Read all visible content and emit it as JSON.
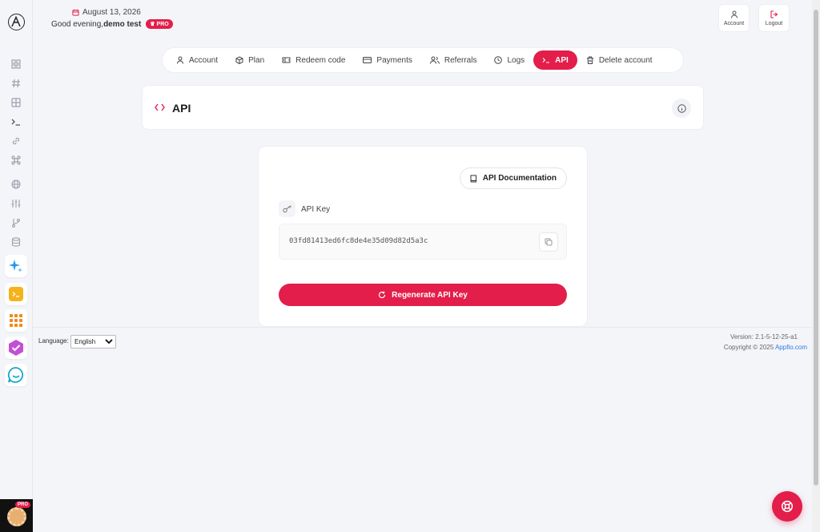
{
  "colors": {
    "accent": "#e31e4a",
    "link": "#2a7ae2",
    "background": "#f4f5f9"
  },
  "header": {
    "date": "August 13, 2026",
    "greeting": "Good evening,",
    "user_name": "demo test",
    "pro_label": "PRO",
    "account_label": "Account",
    "logout_label": "Logout"
  },
  "sidebar": {
    "icons": [
      "grid-icon",
      "hash-icon",
      "table-icon",
      "terminal-icon",
      "link-icon",
      "command-icon",
      "globe-icon",
      "sliders-icon",
      "git-branch-icon",
      "database-icon"
    ],
    "apps": [
      "sparkle-app-icon",
      "terminal-app-icon",
      "grid-app-icon",
      "check-app-icon",
      "chat-app-icon"
    ],
    "avatar_pro_label": "PRO"
  },
  "tabs": [
    {
      "label": "Account",
      "icon": "user-icon"
    },
    {
      "label": "Plan",
      "icon": "box-icon"
    },
    {
      "label": "Redeem code",
      "icon": "ticket-icon"
    },
    {
      "label": "Payments",
      "icon": "credit-card-icon"
    },
    {
      "label": "Referrals",
      "icon": "users-icon"
    },
    {
      "label": "Logs",
      "icon": "clock-icon"
    },
    {
      "label": "API",
      "icon": "terminal-icon",
      "active": true
    },
    {
      "label": "Delete account",
      "icon": "trash-icon"
    }
  ],
  "page": {
    "title": "API"
  },
  "api": {
    "doc_button": "API Documentation",
    "key_label": "API Key",
    "key_value": "03fd81413ed6fc8de4e35d09d82d5a3c",
    "regenerate_button": "Regenerate API Key"
  },
  "footer": {
    "language_label": "Language:",
    "language_value": "English",
    "version": "Version: 2.1-5-12-25-a1",
    "copyright_prefix": "Copyright © 2025 ",
    "copyright_link": "Appfio.com"
  }
}
